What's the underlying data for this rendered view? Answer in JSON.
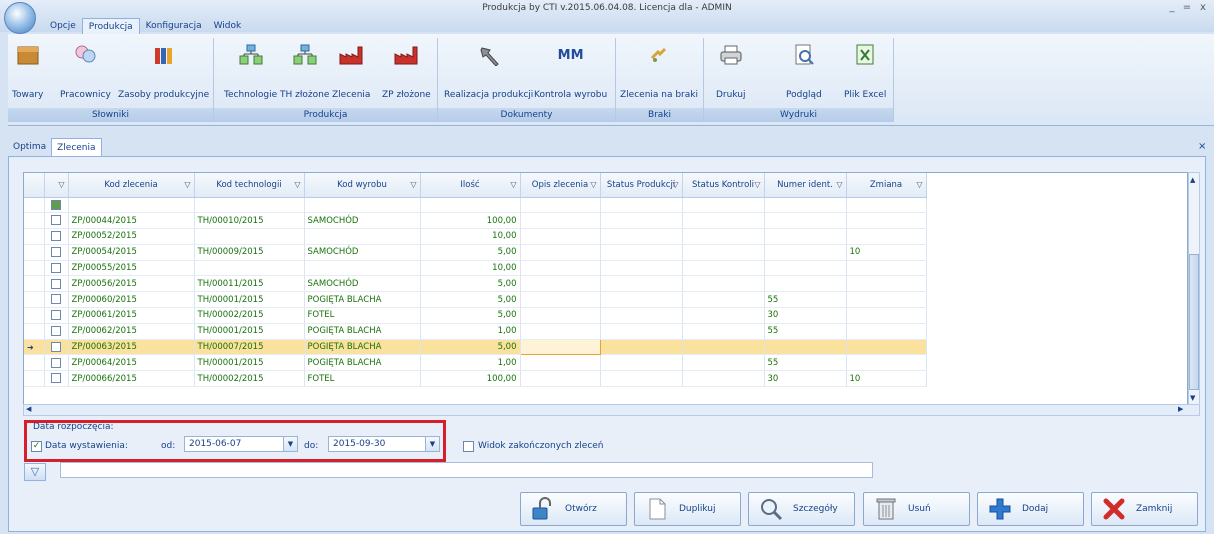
{
  "window": {
    "title": "Produkcja by CTI v.2015.06.04.08. Licencja dla  - ADMIN",
    "controls": [
      "_",
      "=",
      "x"
    ]
  },
  "menu_tabs": [
    "Opcje",
    "Produkcja",
    "Konfiguracja",
    "Widok"
  ],
  "ribbon": {
    "groups": [
      {
        "title": "Słowniki",
        "buttons": [
          {
            "label": "Towary",
            "icon": "box-icon"
          },
          {
            "label": "Pracownicy",
            "icon": "users-icon"
          },
          {
            "label": "Zasoby produkcyjne",
            "icon": "books-icon"
          }
        ]
      },
      {
        "title": "Produkcja",
        "buttons": [
          {
            "label": "Technologie",
            "icon": "hierarchy-icon"
          },
          {
            "label": "TH złożone",
            "icon": "hierarchy-icon"
          },
          {
            "label": "Zlecenia",
            "icon": "factory-icon"
          },
          {
            "label": "ZP złożone",
            "icon": "factory-icon"
          }
        ]
      },
      {
        "title": "Dokumenty",
        "buttons": [
          {
            "label": "Realizacja produkcji",
            "icon": "hammer-icon"
          },
          {
            "label": "Kontrola wyrobu",
            "icon": "mm-icon",
            "icon_text": "MM"
          }
        ]
      },
      {
        "title": "Braki",
        "buttons": [
          {
            "label": "Zlecenia na braki",
            "icon": "broken-icon"
          }
        ]
      },
      {
        "title": "Wydruki",
        "buttons": [
          {
            "label": "Drukuj",
            "icon": "printer-icon"
          },
          {
            "label": "Podgląd",
            "icon": "preview-icon"
          },
          {
            "label": "Plik Excel",
            "icon": "excel-icon"
          }
        ]
      }
    ]
  },
  "doc_tabs": [
    "Optima",
    "Zlecenia"
  ],
  "grid": {
    "columns": [
      "Kod zlecenia",
      "Kod technologii",
      "Kod wyrobu",
      "Ilość",
      "Opis zlecenia",
      "Status Produkcji",
      "Status Kontroli",
      "Numer ident.",
      "Zmiana"
    ],
    "rows": [
      {
        "kod": "ZP/00044/2015",
        "tech": "TH/00010/2015",
        "wyrob": "SAMOCHÓD",
        "ilosc": "100,00",
        "opis": "",
        "sprod": "",
        "skontr": "",
        "nr": "",
        "zmiana": ""
      },
      {
        "kod": "ZP/00052/2015",
        "tech": "",
        "wyrob": "",
        "ilosc": "10,00",
        "opis": "",
        "sprod": "",
        "skontr": "",
        "nr": "",
        "zmiana": ""
      },
      {
        "kod": "ZP/00054/2015",
        "tech": "TH/00009/2015",
        "wyrob": "SAMOCHÓD",
        "ilosc": "5,00",
        "opis": "",
        "sprod": "",
        "skontr": "",
        "nr": "",
        "zmiana": "10"
      },
      {
        "kod": "ZP/00055/2015",
        "tech": "",
        "wyrob": "",
        "ilosc": "10,00",
        "opis": "",
        "sprod": "",
        "skontr": "",
        "nr": "",
        "zmiana": ""
      },
      {
        "kod": "ZP/00056/2015",
        "tech": "TH/00011/2015",
        "wyrob": "SAMOCHÓD",
        "ilosc": "5,00",
        "opis": "",
        "sprod": "",
        "skontr": "",
        "nr": "",
        "zmiana": ""
      },
      {
        "kod": "ZP/00060/2015",
        "tech": "TH/00001/2015",
        "wyrob": "POGIĘTA BLACHA",
        "ilosc": "5,00",
        "opis": "",
        "sprod": "",
        "skontr": "",
        "nr": "55",
        "zmiana": ""
      },
      {
        "kod": "ZP/00061/2015",
        "tech": "TH/00002/2015",
        "wyrob": "FOTEL",
        "ilosc": "5,00",
        "opis": "",
        "sprod": "",
        "skontr": "",
        "nr": "30",
        "zmiana": ""
      },
      {
        "kod": "ZP/00062/2015",
        "tech": "TH/00001/2015",
        "wyrob": "POGIĘTA BLACHA",
        "ilosc": "1,00",
        "opis": "",
        "sprod": "",
        "skontr": "",
        "nr": "55",
        "zmiana": ""
      },
      {
        "kod": "ZP/00063/2015",
        "tech": "TH/00007/2015",
        "wyrob": "POGIĘTA BLACHA",
        "ilosc": "5,00",
        "opis": "",
        "sprod": "",
        "skontr": "",
        "nr": "",
        "zmiana": ""
      },
      {
        "kod": "ZP/00064/2015",
        "tech": "TH/00001/2015",
        "wyrob": "POGIĘTA BLACHA",
        "ilosc": "1,00",
        "opis": "",
        "sprod": "",
        "skontr": "",
        "nr": "55",
        "zmiana": ""
      },
      {
        "kod": "ZP/00066/2015",
        "tech": "TH/00002/2015",
        "wyrob": "FOTEL",
        "ilosc": "100,00",
        "opis": "",
        "sprod": "",
        "skontr": "",
        "nr": "30",
        "zmiana": "10"
      }
    ],
    "selected_index": 8,
    "colors": {
      "selected_row": "#fbe19e",
      "text": "#17730a",
      "filter_box": "#d61f2a"
    }
  },
  "filter": {
    "group_title": "Data rozpoczęcia:",
    "checkbox_label": "Data wystawienia:",
    "checkbox_checked": true,
    "from_label": "od:",
    "from_value": "2015-06-07",
    "to_label": "do:",
    "to_value": "2015-09-30",
    "finished_label": "Widok zakończonych zleceń",
    "finished_checked": false
  },
  "buttons": [
    {
      "label": "Otwórz",
      "icon": "lock-open-icon"
    },
    {
      "label": "Duplikuj",
      "icon": "document-icon"
    },
    {
      "label": "Szczegóły",
      "icon": "magnifier-icon"
    },
    {
      "label": "Usuń",
      "icon": "trash-icon"
    },
    {
      "label": "Dodaj",
      "icon": "plus-icon"
    },
    {
      "label": "Zamknij",
      "icon": "x-icon"
    }
  ]
}
